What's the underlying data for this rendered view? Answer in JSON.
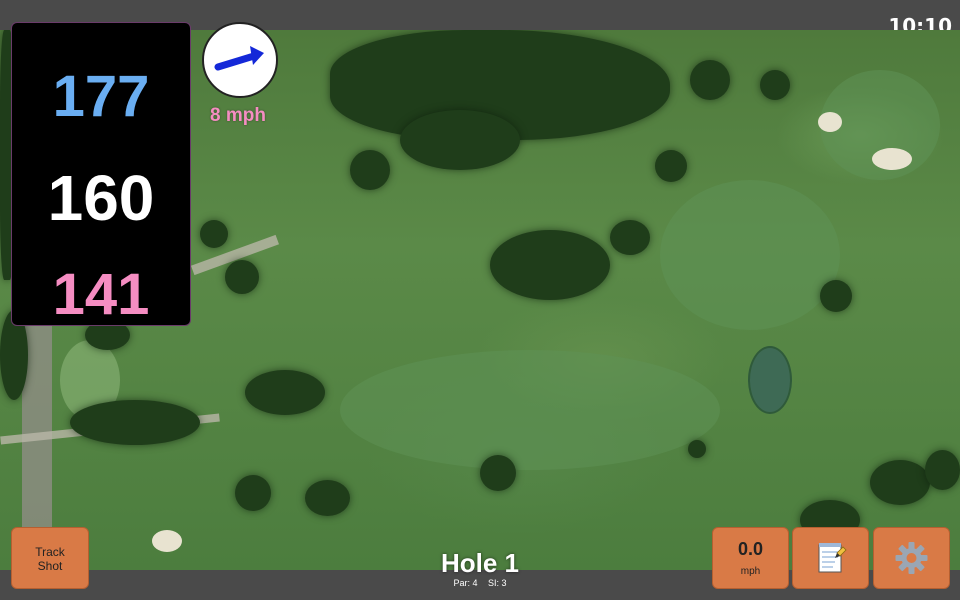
{
  "status": {
    "time": "10:10"
  },
  "distances": {
    "back": "177",
    "middle": "160",
    "front": "141"
  },
  "wind": {
    "speed_label": "8 mph",
    "icon": "wind-direction-arrow-icon"
  },
  "buttons": {
    "track_shot_line1": "Track",
    "track_shot_line2": "Shot",
    "speed_value": "0.0",
    "speed_unit": "mph",
    "notes_icon": "notepad-icon",
    "settings_icon": "gear-icon"
  },
  "hole": {
    "title": "Hole 1",
    "par": "Par: 4",
    "si": "SI: 3"
  },
  "colors": {
    "back": "#6aaef2",
    "middle": "#ffffff",
    "front": "#f58dc2",
    "button": "#d97a46"
  }
}
